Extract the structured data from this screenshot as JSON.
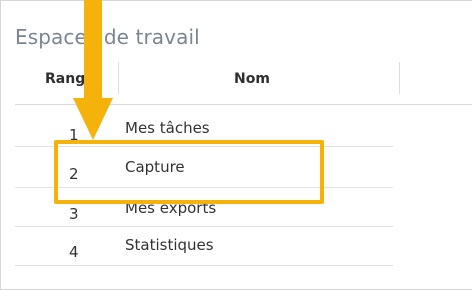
{
  "panel": {
    "title": "Espaces de travail"
  },
  "table": {
    "columns": [
      "Rang",
      "Nom"
    ],
    "rows": [
      {
        "rank": "1",
        "name": "Mes tâches"
      },
      {
        "rank": "2",
        "name": "Capture"
      },
      {
        "rank": "3",
        "name": "Mes exports"
      },
      {
        "rank": "4",
        "name": "Statistiques"
      }
    ]
  },
  "annotation": {
    "color": "#f5b20b",
    "highlighted_row": "Capture"
  }
}
